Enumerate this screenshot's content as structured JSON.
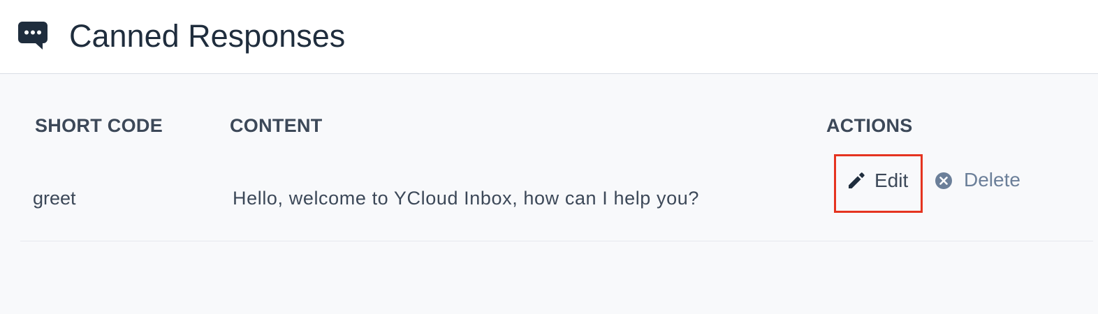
{
  "header": {
    "title": "Canned Responses",
    "icon": "chat-bubble-icon"
  },
  "table": {
    "columns": [
      "SHORT CODE",
      "CONTENT",
      "ACTIONS"
    ],
    "rows": [
      {
        "short_code": "greet",
        "content": "Hello, welcome to YCloud Inbox, how can I help you?",
        "actions": {
          "edit_label": "Edit",
          "edit_icon": "pencil-icon",
          "delete_label": "Delete",
          "delete_icon": "close-circle-icon"
        }
      }
    ]
  },
  "colors": {
    "text_primary": "#1f2d3d",
    "text_secondary": "#3c4858",
    "delete_text": "#6b7f99",
    "highlight_border": "#e53420",
    "background": "#f8f9fb"
  }
}
